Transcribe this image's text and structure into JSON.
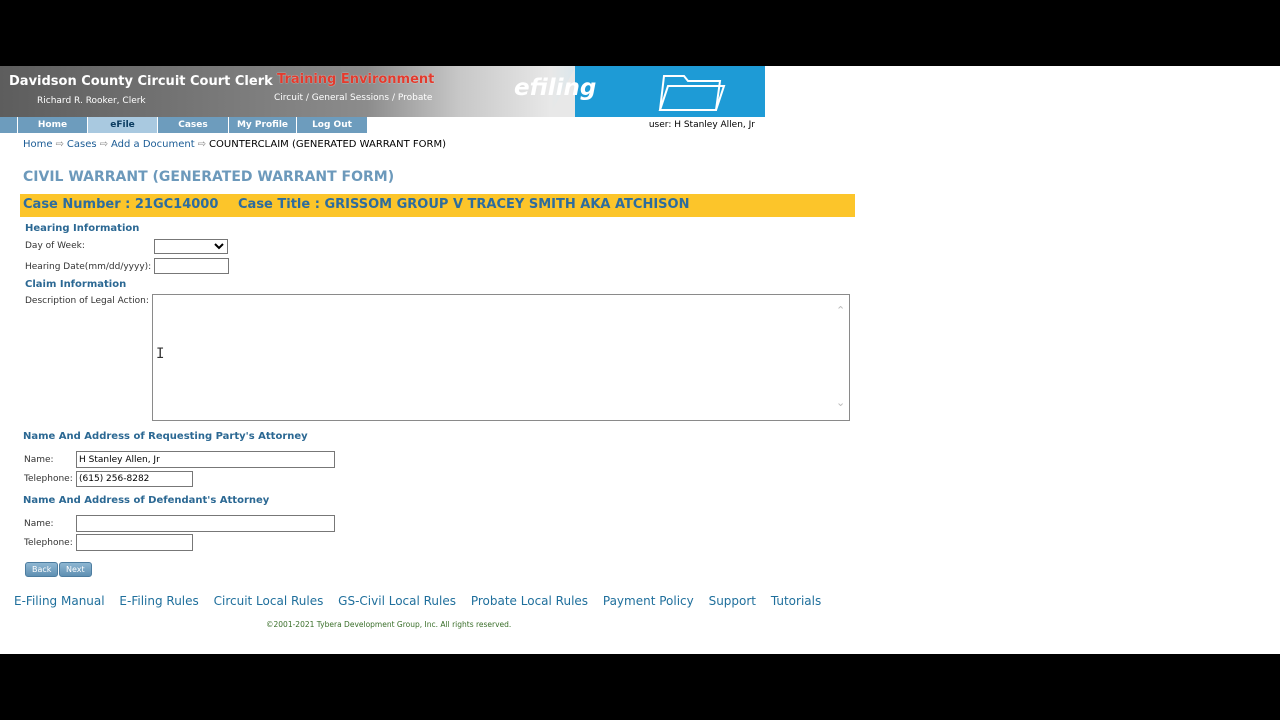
{
  "header": {
    "court_name": "Davidson County Circuit Court Clerk",
    "clerk_name": "Richard R. Rooker, Clerk",
    "environment": "Training Environment",
    "courts": "Circuit / General Sessions / Probate",
    "logo_text": "efiling"
  },
  "nav": {
    "items": [
      {
        "label": "Home"
      },
      {
        "label": "eFile"
      },
      {
        "label": "Cases"
      },
      {
        "label": "My Profile"
      },
      {
        "label": "Log Out"
      }
    ],
    "user": "user: H Stanley Allen, Jr"
  },
  "breadcrumb": {
    "home": "Home",
    "cases": "Cases",
    "add_document": "Add a Document",
    "current": "COUNTERCLAIM (GENERATED WARRANT FORM)"
  },
  "page_title": "CIVIL WARRANT (GENERATED WARRANT FORM)",
  "case": {
    "number": "Case Number : 21GC14000",
    "title": "Case Title : GRISSOM GROUP V TRACEY SMITH AKA ATCHISON"
  },
  "hearing": {
    "heading": "Hearing Information",
    "day_label": "Day of Week:",
    "day_value": "",
    "date_label": "Hearing Date(mm/dd/yyyy):",
    "date_value": ""
  },
  "claim": {
    "heading": "Claim Information",
    "desc_label": "Description of Legal Action:",
    "desc_value": ""
  },
  "requesting_attorney": {
    "heading": "Name And Address of Requesting Party's Attorney",
    "name_label": "Name:",
    "name_value": "H Stanley Allen, Jr",
    "phone_label": "Telephone:",
    "phone_value": "(615) 256-8282"
  },
  "defendant_attorney": {
    "heading": "Name And Address of Defendant's Attorney",
    "name_label": "Name:",
    "name_value": "",
    "phone_label": "Telephone:",
    "phone_value": ""
  },
  "buttons": {
    "back": "Back",
    "next": "Next"
  },
  "footer": {
    "links": [
      "E-Filing Manual",
      "E-Filing Rules",
      "Circuit Local Rules",
      "GS-Civil Local Rules",
      "Probate Local Rules",
      "Payment Policy",
      "Support",
      "Tutorials"
    ],
    "copyright": "©2001-2021 Tybera Development Group, Inc. All rights reserved."
  },
  "colors": {
    "accent_blue": "#2b6893",
    "case_bar": "#fcc52a",
    "nav_blue": "#6d9cbd"
  }
}
